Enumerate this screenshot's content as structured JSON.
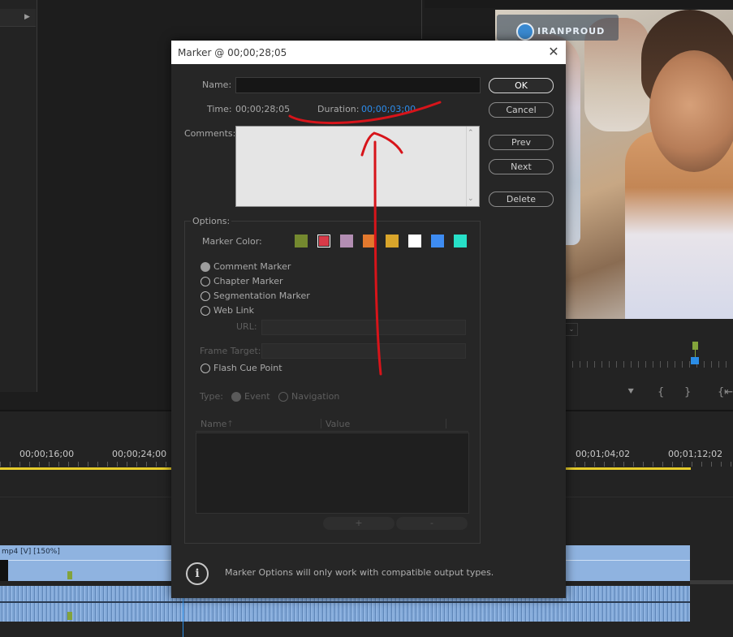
{
  "dialog": {
    "title": "Marker @ 00;00;28;05",
    "name_label": "Name:",
    "name_value": "",
    "time_label": "Time:",
    "time_value": "00;00;28;05",
    "duration_label": "Duration:",
    "duration_value": "00;00;03;00",
    "comments_label": "Comments:",
    "comments_value": "",
    "buttons": {
      "ok": "OK",
      "cancel": "Cancel",
      "prev": "Prev",
      "next": "Next",
      "delete": "Delete"
    },
    "options": {
      "group_label": "Options:",
      "marker_color_label": "Marker Color:",
      "colors": [
        "#74892f",
        "#d93a48",
        "#b38eb3",
        "#e3792e",
        "#d9a52b",
        "#ffffff",
        "#3e8cf2",
        "#27e0c8"
      ],
      "selected_color_index": 1,
      "marker_types": [
        {
          "label": "Comment Marker",
          "checked": true
        },
        {
          "label": "Chapter Marker",
          "checked": false
        },
        {
          "label": "Segmentation Marker",
          "checked": false
        },
        {
          "label": "Web Link",
          "checked": false
        }
      ],
      "url_label": "URL:",
      "frame_target_label": "Frame Target:",
      "flash_cue_label": "Flash Cue Point",
      "type_label": "Type:",
      "type_options": [
        "Event",
        "Navigation"
      ],
      "table_headers": [
        "Name",
        "Value"
      ],
      "add_button": "+",
      "remove_button": "-"
    },
    "info_text": "Marker Options will only work with compatible output types."
  },
  "video": {
    "watermark": "IRANPROUD"
  },
  "timeline": {
    "timecodes": [
      "00;00;16;00",
      "00;00;24;00",
      "00;01;04;02",
      "00;01;12;02"
    ],
    "clip_label": "mp4 [V] [150%]"
  },
  "colors": {
    "annotation_red": "#d7141a",
    "accent_blue": "#2d8ceb",
    "track_yellow": "#e6cc2b"
  }
}
